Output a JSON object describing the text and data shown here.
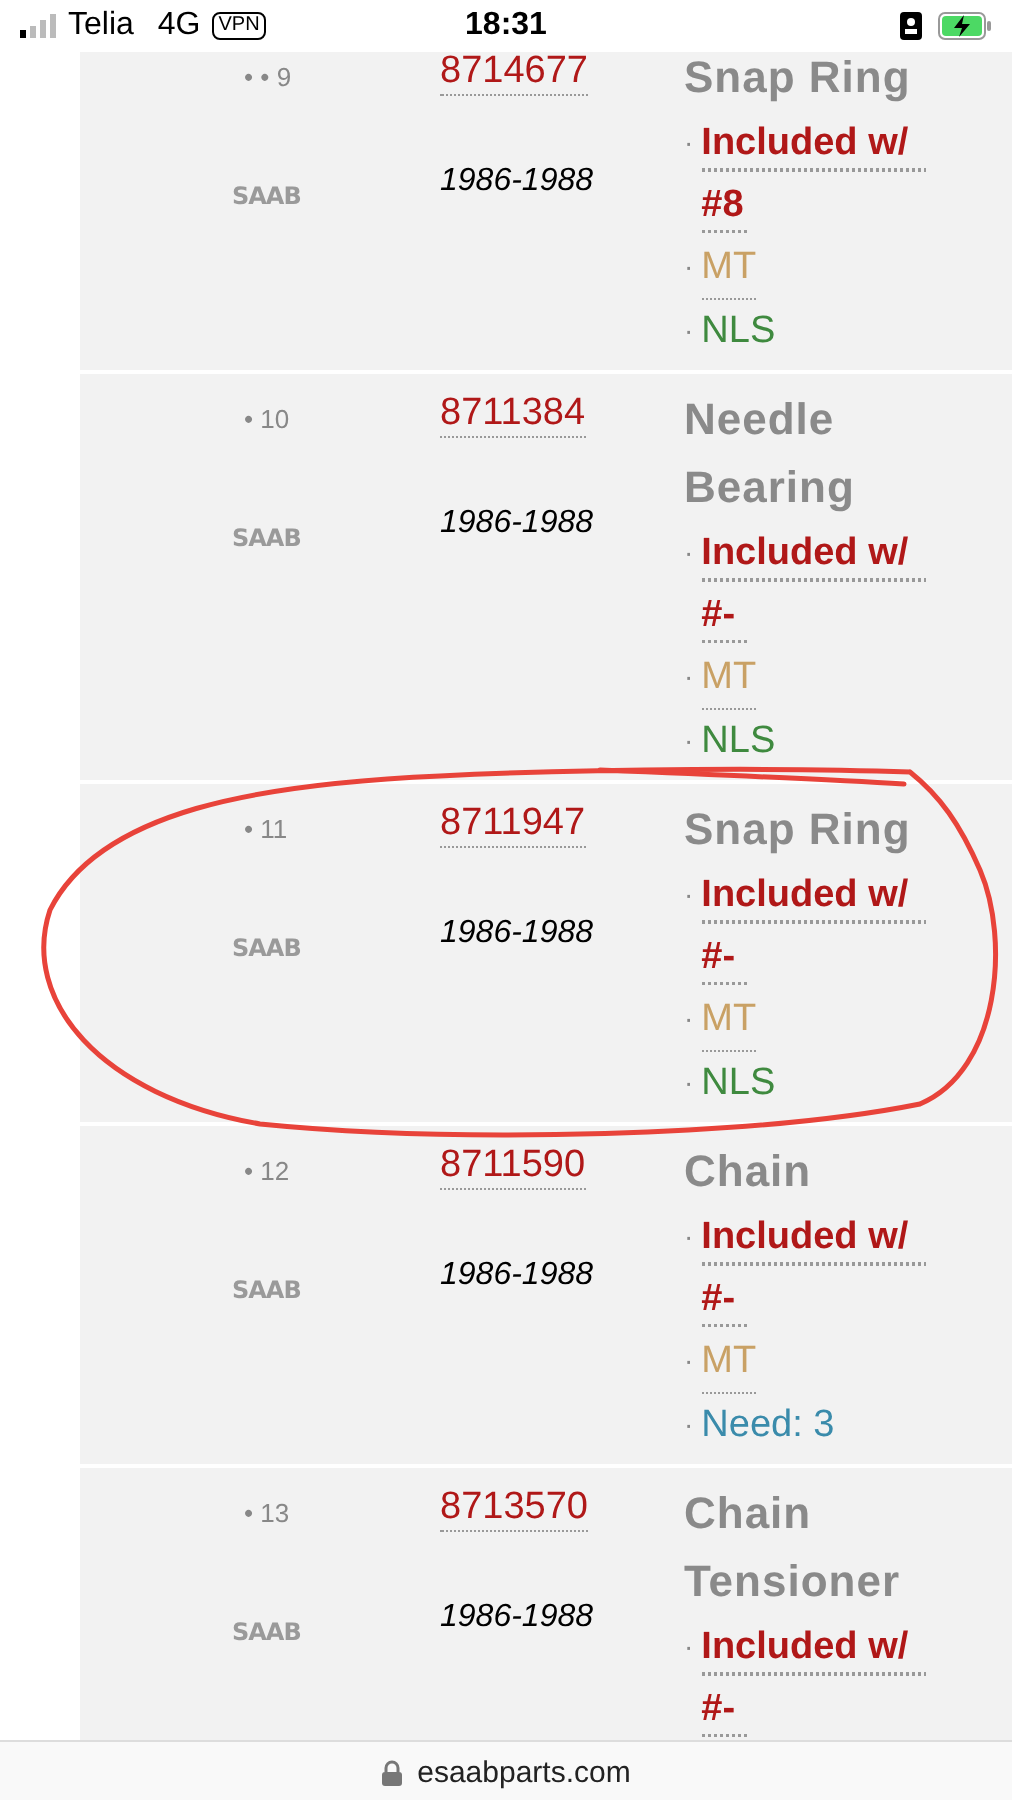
{
  "status_bar": {
    "carrier": "Telia",
    "network": "4G",
    "vpn": "VPN",
    "time": "18:31"
  },
  "rows": [
    {
      "number": "• • 9",
      "part_number": "8714677",
      "brand": "SAAB",
      "years": "1986-1988",
      "name": "Snap Ring",
      "notes": [
        {
          "kind": "included",
          "marker": "·",
          "text": "Included w/ #8"
        },
        {
          "kind": "mt",
          "marker": "·",
          "text": "MT"
        },
        {
          "kind": "nls",
          "marker": "·",
          "text": "NLS"
        }
      ]
    },
    {
      "number": "• 10",
      "part_number": "8711384",
      "brand": "SAAB",
      "years": "1986-1988",
      "name": "Needle Bearing",
      "notes": [
        {
          "kind": "included",
          "marker": "·",
          "text": "Included w/ #-"
        },
        {
          "kind": "mt",
          "marker": "·",
          "text": "MT"
        },
        {
          "kind": "nls",
          "marker": "·",
          "text": "NLS"
        }
      ]
    },
    {
      "number": "• 11",
      "part_number": "8711947",
      "brand": "SAAB",
      "years": "1986-1988",
      "name": "Snap Ring",
      "notes": [
        {
          "kind": "included",
          "marker": "·",
          "text": "Included w/ #-"
        },
        {
          "kind": "mt",
          "marker": "·",
          "text": "MT"
        },
        {
          "kind": "nls",
          "marker": "·",
          "text": "NLS"
        }
      ]
    },
    {
      "number": "• 12",
      "part_number": "8711590",
      "brand": "SAAB",
      "years": "1986-1988",
      "name": "Chain",
      "notes": [
        {
          "kind": "included",
          "marker": "·",
          "text": "Included w/ #-"
        },
        {
          "kind": "mt",
          "marker": "·",
          "text": "MT"
        },
        {
          "kind": "need",
          "marker": "·",
          "text": "Need: 3"
        }
      ]
    },
    {
      "number": "• 13",
      "part_number": "8713570",
      "brand": "SAAB",
      "years": "1986-1988",
      "name": "Chain Tensioner",
      "notes": [
        {
          "kind": "included",
          "marker": "·",
          "text": "Included w/ #-"
        }
      ]
    }
  ],
  "address_bar": {
    "url": "esaabparts.com"
  }
}
